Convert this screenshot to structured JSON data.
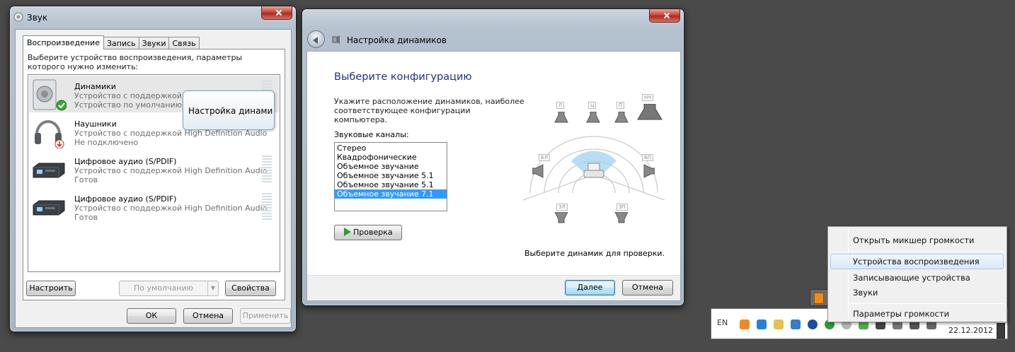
{
  "sound_window": {
    "title": "Звук",
    "tabs": [
      "Воспроизведение",
      "Запись",
      "Звуки",
      "Связь"
    ],
    "description": "Выберите устройство воспроизведения, параметры которого нужно изменить:",
    "devices": [
      {
        "name": "Динамики",
        "line1": "Устройство с поддержкой Hi",
        "line2": "Устройство по умолчанию",
        "icon": "speaker-icon",
        "status_badge": "default-check"
      },
      {
        "name": "Наушники",
        "line1": "Устройство с поддержкой High Definition Audio",
        "line2": "Не подключено",
        "icon": "headphones-icon",
        "status_badge": "unplugged"
      },
      {
        "name": "Цифровое аудио (S/PDIF)",
        "line1": "Устройство с поддержкой High Definition Audio",
        "line2": "Готов",
        "icon": "digital-audio-icon"
      },
      {
        "name": "Цифровое аудио (S/PDIF)",
        "line1": "Устройство с поддержкой High Definition Audio",
        "line2": "Готов",
        "icon": "digital-audio-icon"
      }
    ],
    "tooltip": "Настройка динами",
    "buttons": {
      "configure": "Настроить",
      "set_default": "По умолчанию",
      "properties": "Свойства",
      "ok": "ОК",
      "cancel": "Отмена",
      "apply": "Применить"
    }
  },
  "setup_window": {
    "title": "Настройка динамиков",
    "heading": "Выберите конфигурацию",
    "instruction": "Укажите расположение динамиков, наиболее соответствующее конфигурации компьютера.",
    "channels_label": "Звуковые каналы:",
    "channels": [
      "Стерео",
      "Квадрофонические",
      "Объемное звучание",
      "Объемное звучание 5.1",
      "Объемное звучание 5.1",
      "Объемное звучание 7.1"
    ],
    "selected_channel_index": 5,
    "test_button": "Проверка",
    "hint": "Выберите динамик для проверки.",
    "speaker_labels": [
      "Л",
      "Ц",
      "П",
      "НЧ",
      "БЛ",
      "БП",
      "ЗЛ",
      "ЗП"
    ],
    "buttons": {
      "next": "Далее",
      "cancel": "Отмена"
    }
  },
  "context_menu": {
    "items": [
      "Открыть микшер громкости",
      "Устройства воспроизведения",
      "Записывающие устройства",
      "Звуки",
      "Параметры громкости"
    ],
    "highlighted_index": 1
  },
  "taskbar": {
    "language": "EN",
    "date": "22.12.2012"
  },
  "colors": {
    "heading_blue": "#1e3287",
    "selection_blue": "#3399ff"
  }
}
